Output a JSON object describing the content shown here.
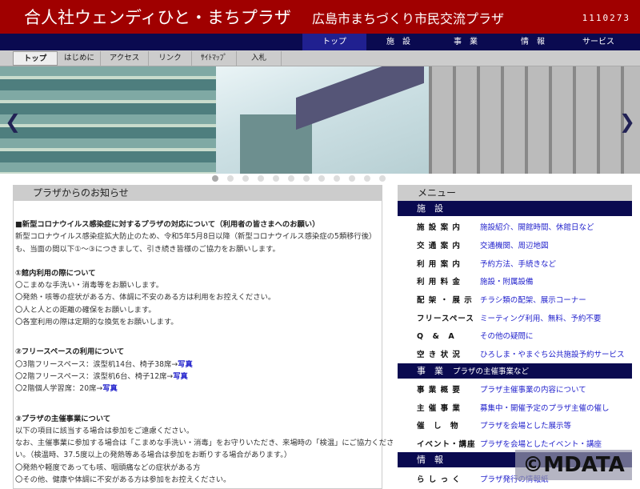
{
  "header": {
    "title": "合人社ウェンディひと・まちプラザ",
    "subtitle": "広島市まちづくり市民交流プラザ",
    "counter": "1110273"
  },
  "nav": [
    "トップ",
    "施　設",
    "事　業",
    "情　報",
    "サービス"
  ],
  "subnav": [
    "トップ",
    "はじめに",
    "アクセス",
    "リンク",
    "ｻｲﾄﾏｯﾌﾟ",
    "入札"
  ],
  "carousel": {
    "prev": "❮",
    "next": "❯",
    "slides": 12,
    "active": 0
  },
  "notice": {
    "heading": "プラザからのお知らせ",
    "title": "■新型コロナウイルス感染症に対するプラザの対応について（利用者の皆さまへのお願い）",
    "intro1": "新型コロナウイルス感染症拡大防止のため、令和5年5月8日以降（新型コロナウイルス感染症の5類移行後）",
    "intro2": "も、当面の間以下①～③につきまして、引き続き皆様のご協力をお願いします。",
    "s1": "①館内利用の際について",
    "s1i": [
      "〇こまめな手洗い・消毒等をお願いします。",
      "〇発熱・咳等の症状がある方、体調に不安のある方は利用をお控えください。",
      "〇人と人との距離の確保をお願いします。",
      "〇各室利用の際は定期的な換気をお願いします。"
    ],
    "s2": "②フリースペースの利用について",
    "s2i": [
      {
        "t": "〇3階フリースペース：涙型机14台、椅子38席→",
        "l": "写真"
      },
      {
        "t": "〇2階フリースペース：涙型机6台、椅子12席→",
        "l": "写真"
      },
      {
        "t": "〇2階個人学習席：20席→",
        "l": "写真"
      }
    ],
    "s3": "③プラザの主催事業について",
    "s3i": [
      "以下の項目に該当する場合は参加をご遠慮ください。",
      "なお、主催事業に参加する場合は「こまめな手洗い・消毒」をお守りいただき、来場時の「検温」にご協力くださ",
      "い。（検温時、37.5度以上の発熱等ある場合は参加をお断りする場合があります。）",
      "〇発熱や軽度であっても咳、咽頭痛などの症状がある方",
      "〇その他、健康や体調に不安がある方は参加をお控えください。"
    ]
  },
  "menu": {
    "heading": "メニュー",
    "sections": [
      {
        "title": "施　設",
        "sub": "",
        "rows": [
          [
            "施 設 案 内",
            "施設紹介、開館時間、休館日など"
          ],
          [
            "交 通 案 内",
            "交通機関、周辺地図"
          ],
          [
            "利 用 案 内",
            "予約方法、手続きなど"
          ],
          [
            "利 用 料 金",
            "施設・附属設備"
          ],
          [
            "配 架 ・ 展 示",
            "チラシ類の配架、展示コーナー"
          ],
          [
            "フリースペース",
            "ミーティング利用、無料、予約不要"
          ],
          [
            "Q　&　A",
            "その他の疑問に"
          ],
          [
            "空 き 状 況",
            "ひろしま・やまぐち公共施設予約サービス"
          ]
        ]
      },
      {
        "title": "事　業",
        "sub": "プラザの主催事業など",
        "rows": [
          [
            "事 業 概 要",
            "プラザ主催事業の内容について"
          ],
          [
            "主 催 事 業",
            "募集中・開催予定のプラザ主催の催し"
          ],
          [
            "催　し　物",
            "プラザを会場とした展示等"
          ],
          [
            "イベント・講座",
            "プラザを会場としたイベント・講座"
          ]
        ]
      },
      {
        "title": "情　報",
        "sub": "",
        "rows": [
          [
            "ら し っ く",
            "プラザ発行の情報紙"
          ]
        ]
      }
    ]
  },
  "watermark": "©MDATA"
}
